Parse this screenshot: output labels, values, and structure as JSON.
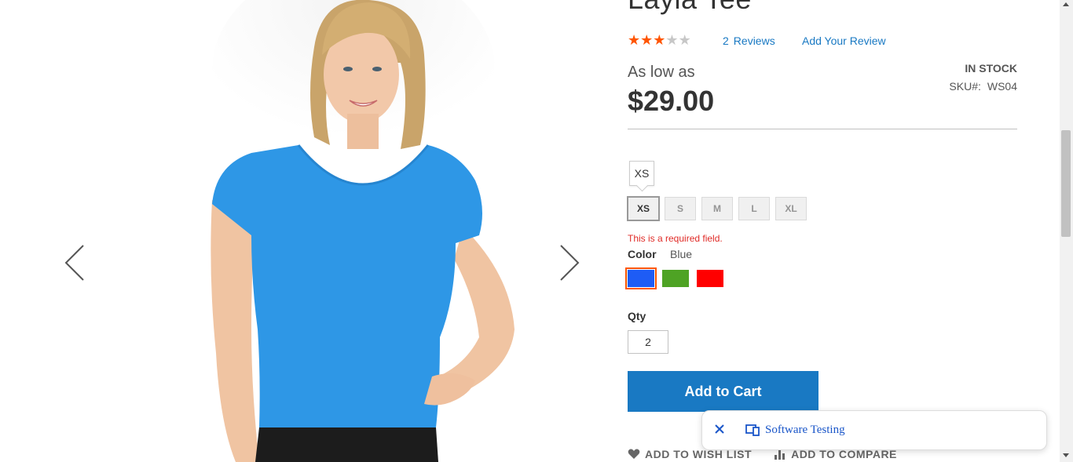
{
  "product": {
    "title": "Layla Tee",
    "rating": {
      "value": 3,
      "max": 5
    },
    "reviews_count": "2",
    "reviews_label": "Reviews",
    "add_review_label": "Add Your Review",
    "price_prefix": "As low as",
    "price": "$29.00",
    "stock": "IN STOCK",
    "sku_label": "SKU#:",
    "sku": "WS04"
  },
  "size": {
    "tooltip": "XS",
    "options": [
      "XS",
      "S",
      "M",
      "L",
      "XL"
    ],
    "selected": "XS",
    "error": "This is a required field."
  },
  "color": {
    "label": "Color",
    "selected_value": "Blue",
    "swatches": [
      {
        "name": "Blue",
        "hex": "#1e5cf5"
      },
      {
        "name": "Green",
        "hex": "#4ea324"
      },
      {
        "name": "Red",
        "hex": "#ff0000"
      }
    ]
  },
  "qty": {
    "label": "Qty",
    "value": "2"
  },
  "add_to_cart": "Add to Cart",
  "actions": {
    "wishlist": "ADD TO WISH LIST",
    "compare": "ADD TO COMPARE"
  },
  "toast": {
    "text": "Software Testing"
  },
  "colors": {
    "accent": "#1979c3",
    "star": "#ff5501",
    "error": "#e02b27",
    "shirt": "#2e97e6"
  }
}
